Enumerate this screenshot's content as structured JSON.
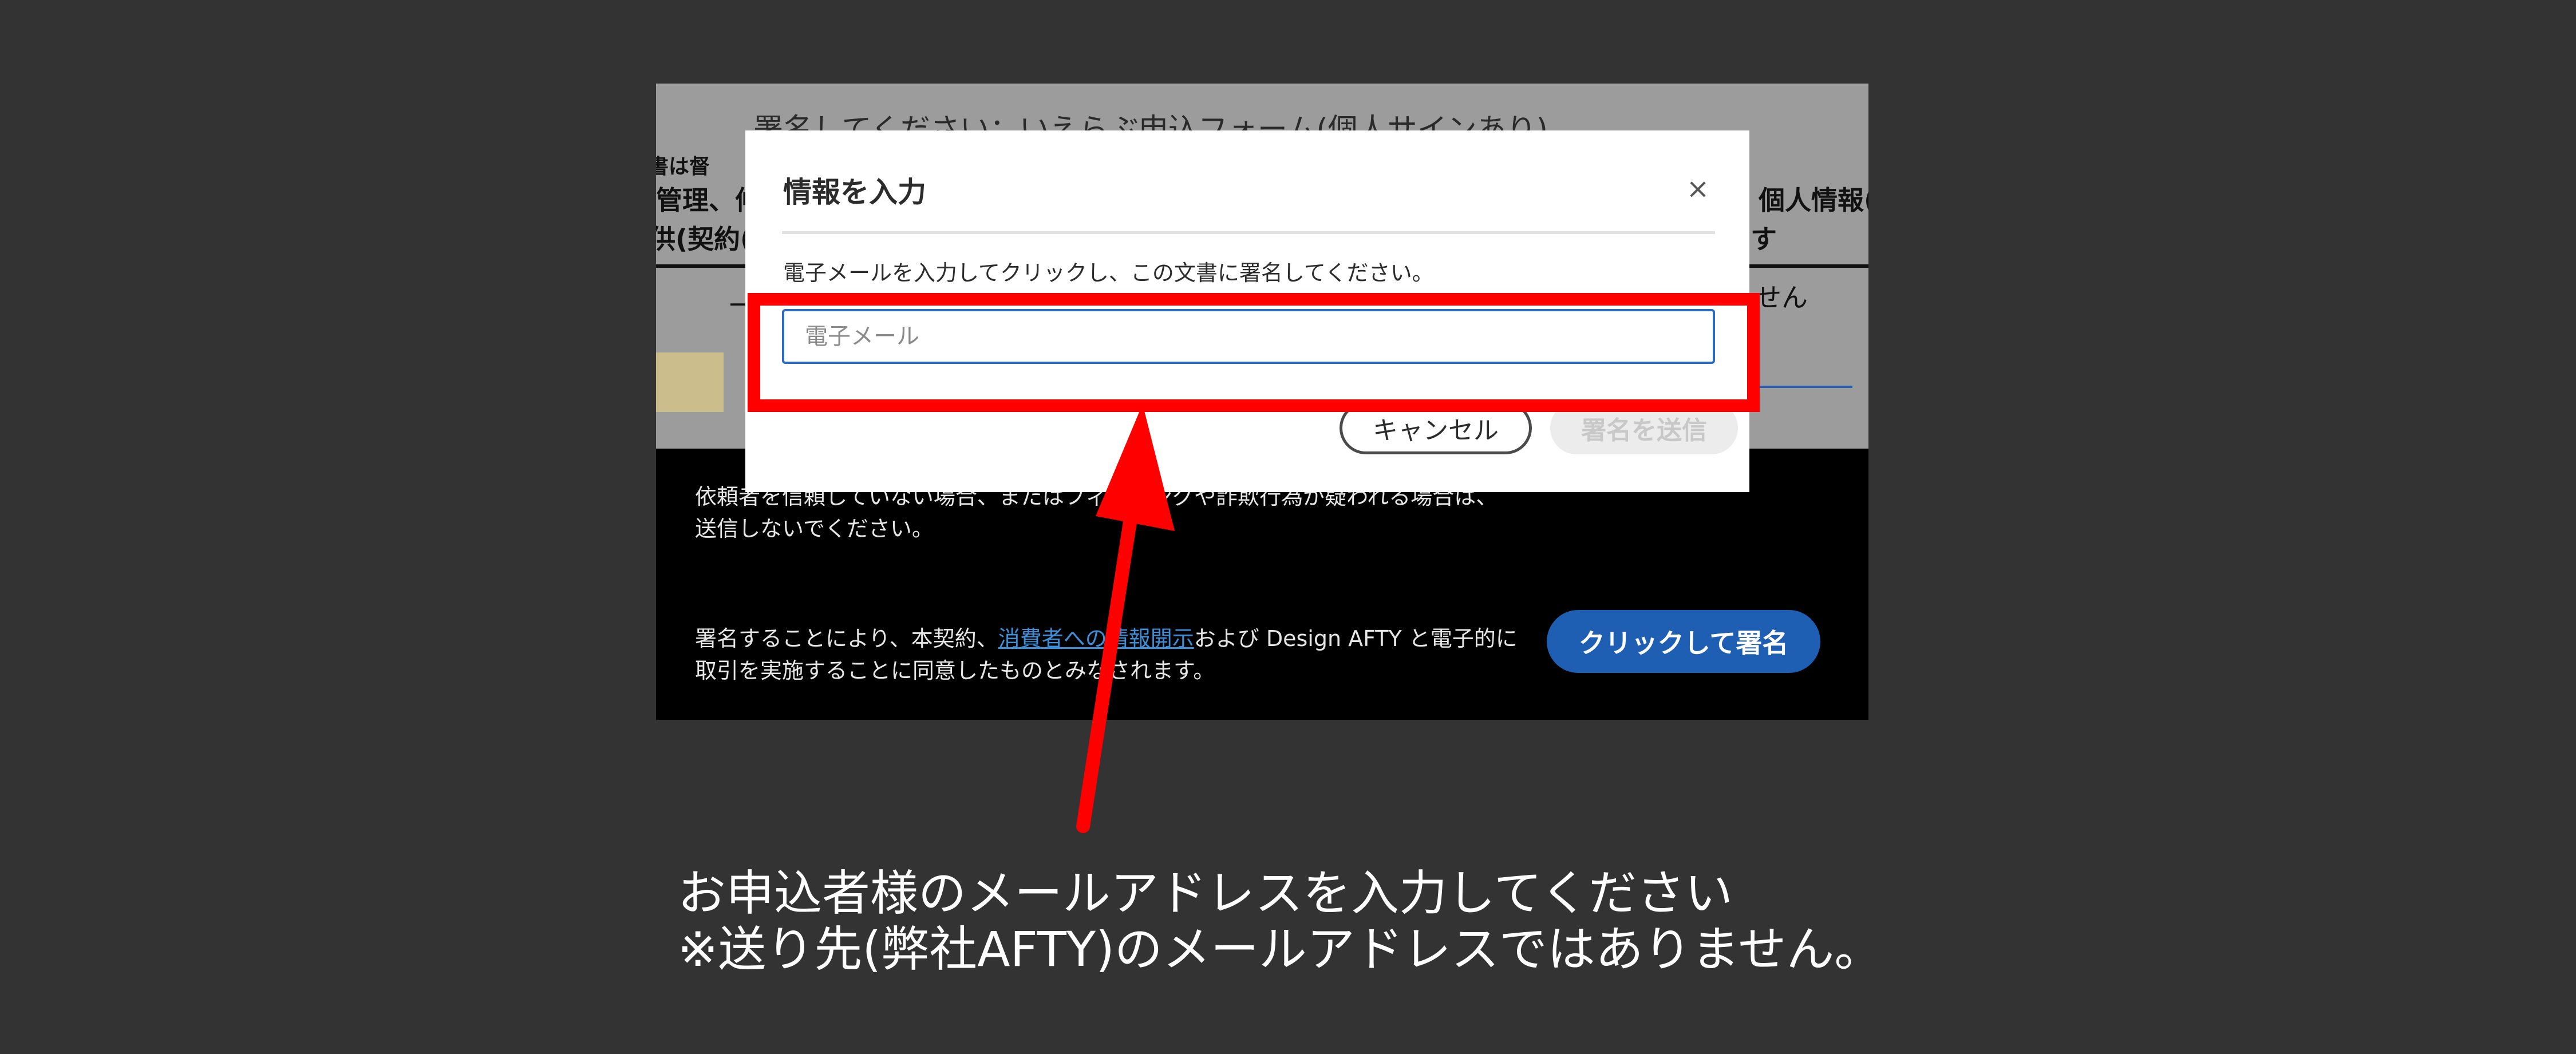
{
  "document": {
    "title": "署名してください：いえらぶ申込フォーム(個人サインあり)",
    "fragments": {
      "line1": "書は督",
      "line2_left": "管理、仲",
      "line2_right": "個人情報(",
      "line3_left": "供(契約(",
      "line3_right": "す",
      "line4_left": "一",
      "line4_right": "せん"
    }
  },
  "footer": {
    "warning_line1": "依頼者を信頼していない場合、またはフィッシングや詐欺行為が疑われる場合は、",
    "warning_line2": "送信しないでください。",
    "consent_before": "署名することにより、本契約、",
    "consent_link": "消費者への情報開示",
    "consent_after": "および Design AFTY と電子的に",
    "consent_line2": "取引を実施することに同意したものとみなされます。",
    "sign_button": "クリックして署名"
  },
  "modal": {
    "title": "情報を入力",
    "close_icon": "close-icon",
    "instruction": "電子メールを入力してクリックし、この文書に署名してください。",
    "email_placeholder": "電子メール",
    "email_value": "",
    "cancel_button": "キャンセル",
    "send_button": "署名を送信"
  },
  "annotation": {
    "highlight_color": "#ff0000",
    "arrow_color": "#ff0000",
    "caption_line1": "お申込者様のメールアドレスを入力してください",
    "caption_line2": "※送り先(弊社AFTY)のメールアドレスではありません。"
  }
}
